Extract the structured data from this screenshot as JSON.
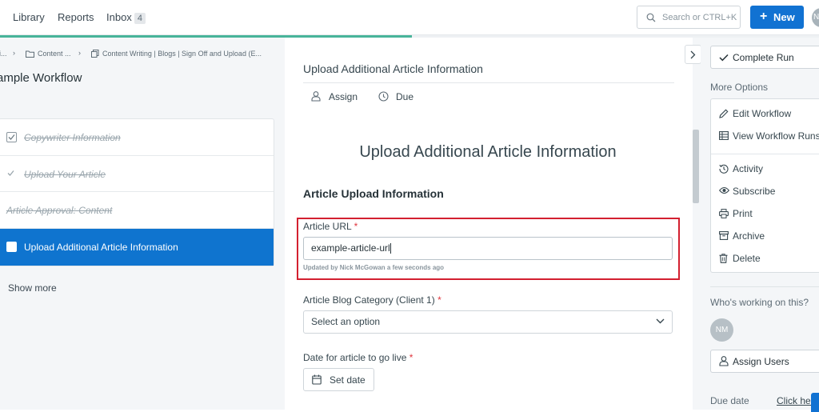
{
  "nav": {
    "library": "Library",
    "reports": "Reports",
    "inbox": "Inbox",
    "inbox_count": "4",
    "search_placeholder": "Search or CTRL+K",
    "new_label": "New",
    "avatar_initials": "N"
  },
  "progress": {
    "fraction": 0.503,
    "color": "#48b49a"
  },
  "breadcrumb": {
    "first": "i...",
    "second": "Content ...",
    "third": "Content Writing | Blogs | Sign Off and Upload (E..."
  },
  "workflow_title": "ample Workflow",
  "tasks": [
    {
      "label": "Copywriter Information",
      "state": "done"
    },
    {
      "label": "Upload Your Article",
      "state": "done"
    },
    {
      "label": "Article Approval: Content",
      "state": "done-nocheck"
    },
    {
      "label": "Upload Additional Article Information",
      "state": "active"
    }
  ],
  "show_more": "Show more",
  "task_header": "Upload Additional Article Information",
  "meta": {
    "assign": "Assign",
    "due": "Due"
  },
  "form": {
    "big_title": "Upload Additional Article Information",
    "section_heading": "Article Upload Information",
    "url_label": "Article URL",
    "url_value": "example-article-url",
    "updated_by": "Updated by Nick McGowan a few seconds ago",
    "category_label": "Article Blog Category (Client 1)",
    "category_value": "Select an option",
    "date_label": "Date for article to go live",
    "date_button": "Set date",
    "required_mark": "*"
  },
  "right": {
    "complete_run": "Complete Run",
    "more_options": "More Options",
    "options": {
      "edit_workflow": "Edit Workflow",
      "view_runs": "View Workflow Runs",
      "activity": "Activity",
      "subscribe": "Subscribe",
      "print": "Print",
      "archive": "Archive",
      "delete": "Delete"
    },
    "who_working": "Who's working on this?",
    "avatar_initials": "NM",
    "assign_users": "Assign Users",
    "due_date": "Due date",
    "click_here": "Click here"
  },
  "colors": {
    "accent": "#1172d2",
    "highlight_box": "#d32030",
    "active_task": "#0f74cf"
  }
}
